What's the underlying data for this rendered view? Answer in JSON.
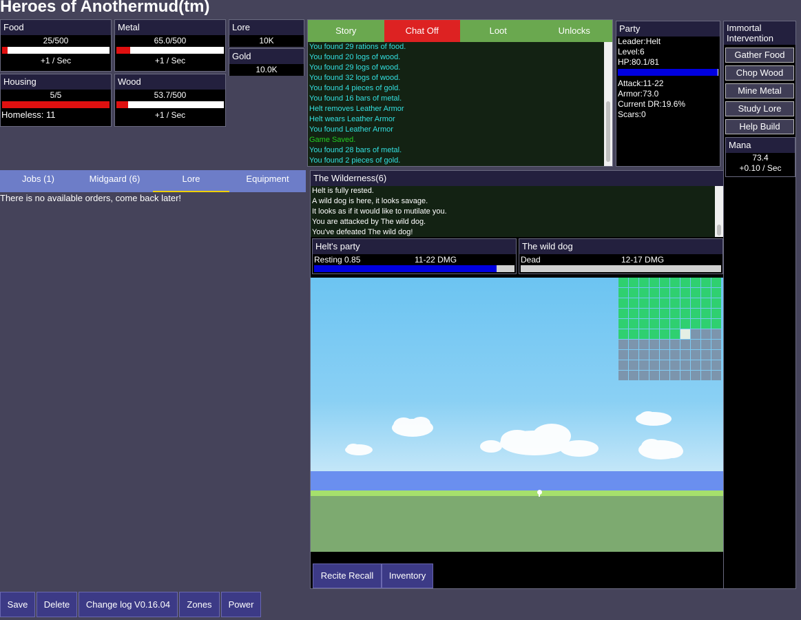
{
  "app": {
    "title": "Heroes of Anothermud(tm)"
  },
  "resources": {
    "food": {
      "label": "Food",
      "value": "25/500",
      "rate": "+1 / Sec",
      "fill": 0.05
    },
    "metal": {
      "label": "Metal",
      "value": "65.0/500",
      "rate": "+1 / Sec",
      "fill": 0.13
    },
    "housing": {
      "label": "Housing",
      "value": "5/5",
      "extra": "Homeless: 11",
      "fill": 1.0
    },
    "wood": {
      "label": "Wood",
      "value": "53.7/500",
      "rate": "+1 / Sec",
      "fill": 0.107
    },
    "lore": {
      "label": "Lore",
      "value": "10K"
    },
    "gold": {
      "label": "Gold",
      "value": "10.0K"
    }
  },
  "log_tabs": [
    {
      "label": "Story",
      "color": "#6aa84f"
    },
    {
      "label": "Chat Off",
      "color": "#dd2222"
    },
    {
      "label": "Loot",
      "color": "#6aa84f"
    },
    {
      "label": "Unlocks",
      "color": "#6aa84f"
    }
  ],
  "story_log": [
    {
      "text": "You found 29 rations of food.",
      "color": "#33e0e0"
    },
    {
      "text": "You found 20 logs of wood.",
      "color": "#33e0e0"
    },
    {
      "text": "You found 29 logs of wood.",
      "color": "#33e0e0"
    },
    {
      "text": "You found 32 logs of wood.",
      "color": "#33e0e0"
    },
    {
      "text": "You found 4 pieces of gold.",
      "color": "#33e0e0"
    },
    {
      "text": "You found 16 bars of metal.",
      "color": "#33e0e0"
    },
    {
      "text": "Helt removes Leather Armor",
      "color": "#33e0e0"
    },
    {
      "text": "Helt wears Leather Armor",
      "color": "#33e0e0"
    },
    {
      "text": "You found Leather Armor",
      "color": "#33e0e0"
    },
    {
      "text": "Game Saved.",
      "color": "#22cc22"
    },
    {
      "text": "You found 28 bars of metal.",
      "color": "#33e0e0"
    },
    {
      "text": "You found 2 pieces of gold.",
      "color": "#33e0e0"
    }
  ],
  "party": {
    "header": "Party",
    "leader": "Leader:Helt",
    "level": "Level:6",
    "hp": "HP:80.1/81",
    "hp_fill": 0.99,
    "attack": "Attack:11-22",
    "armor": "Armor:73.0",
    "dr": "Current DR:19.6%",
    "scars": "Scars:0"
  },
  "immortal": {
    "header": "Immortal Intervention",
    "buttons": [
      "Gather Food",
      "Chop Wood",
      "Mine Metal",
      "Study Lore",
      "Help Build"
    ]
  },
  "mana": {
    "label": "Mana",
    "value": "73.4",
    "rate": "+0.10 / Sec"
  },
  "left_tabs": [
    {
      "label": "Jobs (1)",
      "active": false
    },
    {
      "label": "Midgaard (6)",
      "active": false
    },
    {
      "label": "Lore",
      "active": true
    },
    {
      "label": "Equipment",
      "active": false
    }
  ],
  "orders_message": "There is no available orders, come back later!",
  "zone": {
    "title": "The Wilderness(6)",
    "log": [
      "Helt is fully rested.",
      "A wild dog is here, it looks savage.",
      "It looks as if it would like to mutilate you.",
      "You are attacked by The wild dog.",
      "You've defeated The wild dog!"
    ]
  },
  "combat": {
    "party": {
      "name": "Helt's party",
      "status": "Resting 0.85",
      "dmg": "11-22 DMG",
      "fill": 0.91,
      "color": "#0000e0"
    },
    "enemy": {
      "name": "The wild dog",
      "status": "Dead",
      "dmg": "12-17 DMG",
      "fill": 1.0,
      "color": "#d0d0d0"
    }
  },
  "map": {
    "cols": 10,
    "rows": 10,
    "green_rows": 5,
    "green_extra": 6,
    "white_cell": [
      5,
      6
    ]
  },
  "zone_buttons": [
    "Recite Recall",
    "Inventory"
  ],
  "footer_buttons": [
    "Save",
    "Delete",
    "Change log V0.16.04",
    "Zones",
    "Power"
  ]
}
